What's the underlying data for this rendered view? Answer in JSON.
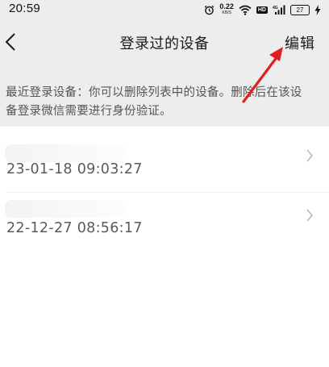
{
  "status_bar": {
    "time": "20:59",
    "net_speed": "0.22",
    "net_unit": "KB/S",
    "hd": "HD",
    "battery": "27"
  },
  "nav": {
    "back_icon": "chevron-left-icon",
    "title": "登录过的设备",
    "edit_label": "编辑"
  },
  "notice": "最近登录设备：你可以删除列表中的设备。删除后在该设备登录微信需要进行身份验证。",
  "devices": [
    {
      "time": "23-01-18 09:03:27"
    },
    {
      "time": "22-12-27 08:56:17"
    }
  ],
  "colors": {
    "header_bg": "#ededed",
    "list_bg": "#ffffff",
    "annotation_arrow": "#e02020"
  }
}
